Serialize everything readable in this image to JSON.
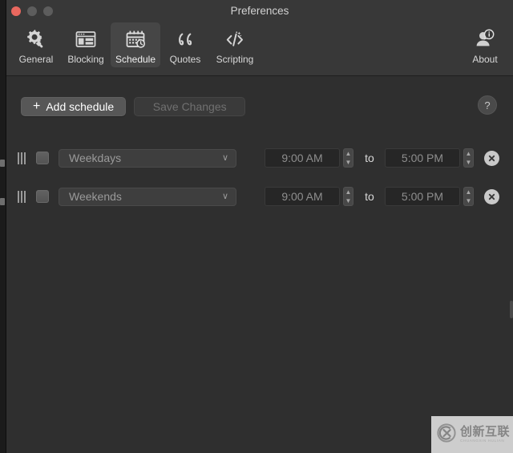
{
  "window": {
    "title": "Preferences",
    "traffic_lights": [
      {
        "name": "close",
        "color": "#e9685f"
      },
      {
        "name": "minimize",
        "color": "#5d5d5d"
      },
      {
        "name": "maximize",
        "color": "#5d5d5d"
      }
    ]
  },
  "toolbar": {
    "items": [
      {
        "label": "General",
        "icon": "gear-wrench-icon",
        "selected": false
      },
      {
        "label": "Blocking",
        "icon": "browser-window-icon",
        "selected": false
      },
      {
        "label": "Schedule",
        "icon": "calendar-clock-icon",
        "selected": true
      },
      {
        "label": "Quotes",
        "icon": "quotation-mark-icon",
        "selected": false
      },
      {
        "label": "Scripting",
        "icon": "code-sparkle-icon",
        "selected": false
      }
    ],
    "right_item": {
      "label": "About",
      "icon": "person-info-icon"
    }
  },
  "actions": {
    "add_schedule_label": "Add schedule",
    "add_schedule_plus": "+",
    "save_changes_label": "Save Changes",
    "save_changes_enabled": false,
    "help_label": "?"
  },
  "schedule": {
    "to_label": "to",
    "stepper_up": "▲",
    "stepper_down": "▼",
    "chevron": "∨",
    "rows": [
      {
        "day_selection": "Weekdays",
        "enabled": false,
        "start_time": "9:00 AM",
        "end_time": "5:00 PM"
      },
      {
        "day_selection": "Weekends",
        "enabled": false,
        "start_time": "9:00 AM",
        "end_time": "5:00 PM"
      }
    ]
  },
  "watermark": {
    "cn_text": "创新互联",
    "en_text": "CHUANGXIN HULIAN"
  },
  "colors": {
    "window_bg": "#2f2f2f",
    "toolbar_bg": "#383838",
    "accent_close": "#e9685f",
    "text_primary": "#d8d8d8",
    "text_muted": "#9a9a9a",
    "text_disabled": "#707070"
  }
}
